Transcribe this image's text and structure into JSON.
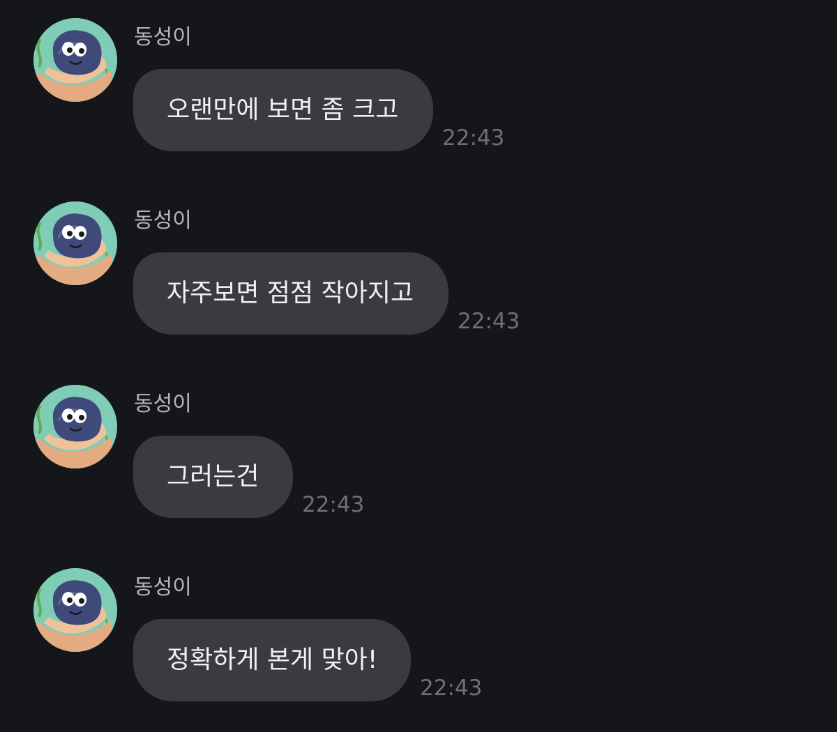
{
  "messages": [
    {
      "sender": "동성이",
      "text": "오랜만에 보면 좀 크고",
      "time": "22:43"
    },
    {
      "sender": "동성이",
      "text": "자주보면 점점 작아지고",
      "time": "22:43"
    },
    {
      "sender": "동성이",
      "text": "그러는건",
      "time": "22:43"
    },
    {
      "sender": "동성이",
      "text": "정확하게 본게 맞아!",
      "time": "22:43"
    }
  ],
  "colors": {
    "background": "#151619",
    "bubble": "#3a3b40",
    "message_text": "#f1f1f3",
    "sender_text": "#b4b6ba",
    "time_text": "#6e7075"
  },
  "avatar_icon": "rock-in-hand-icon"
}
